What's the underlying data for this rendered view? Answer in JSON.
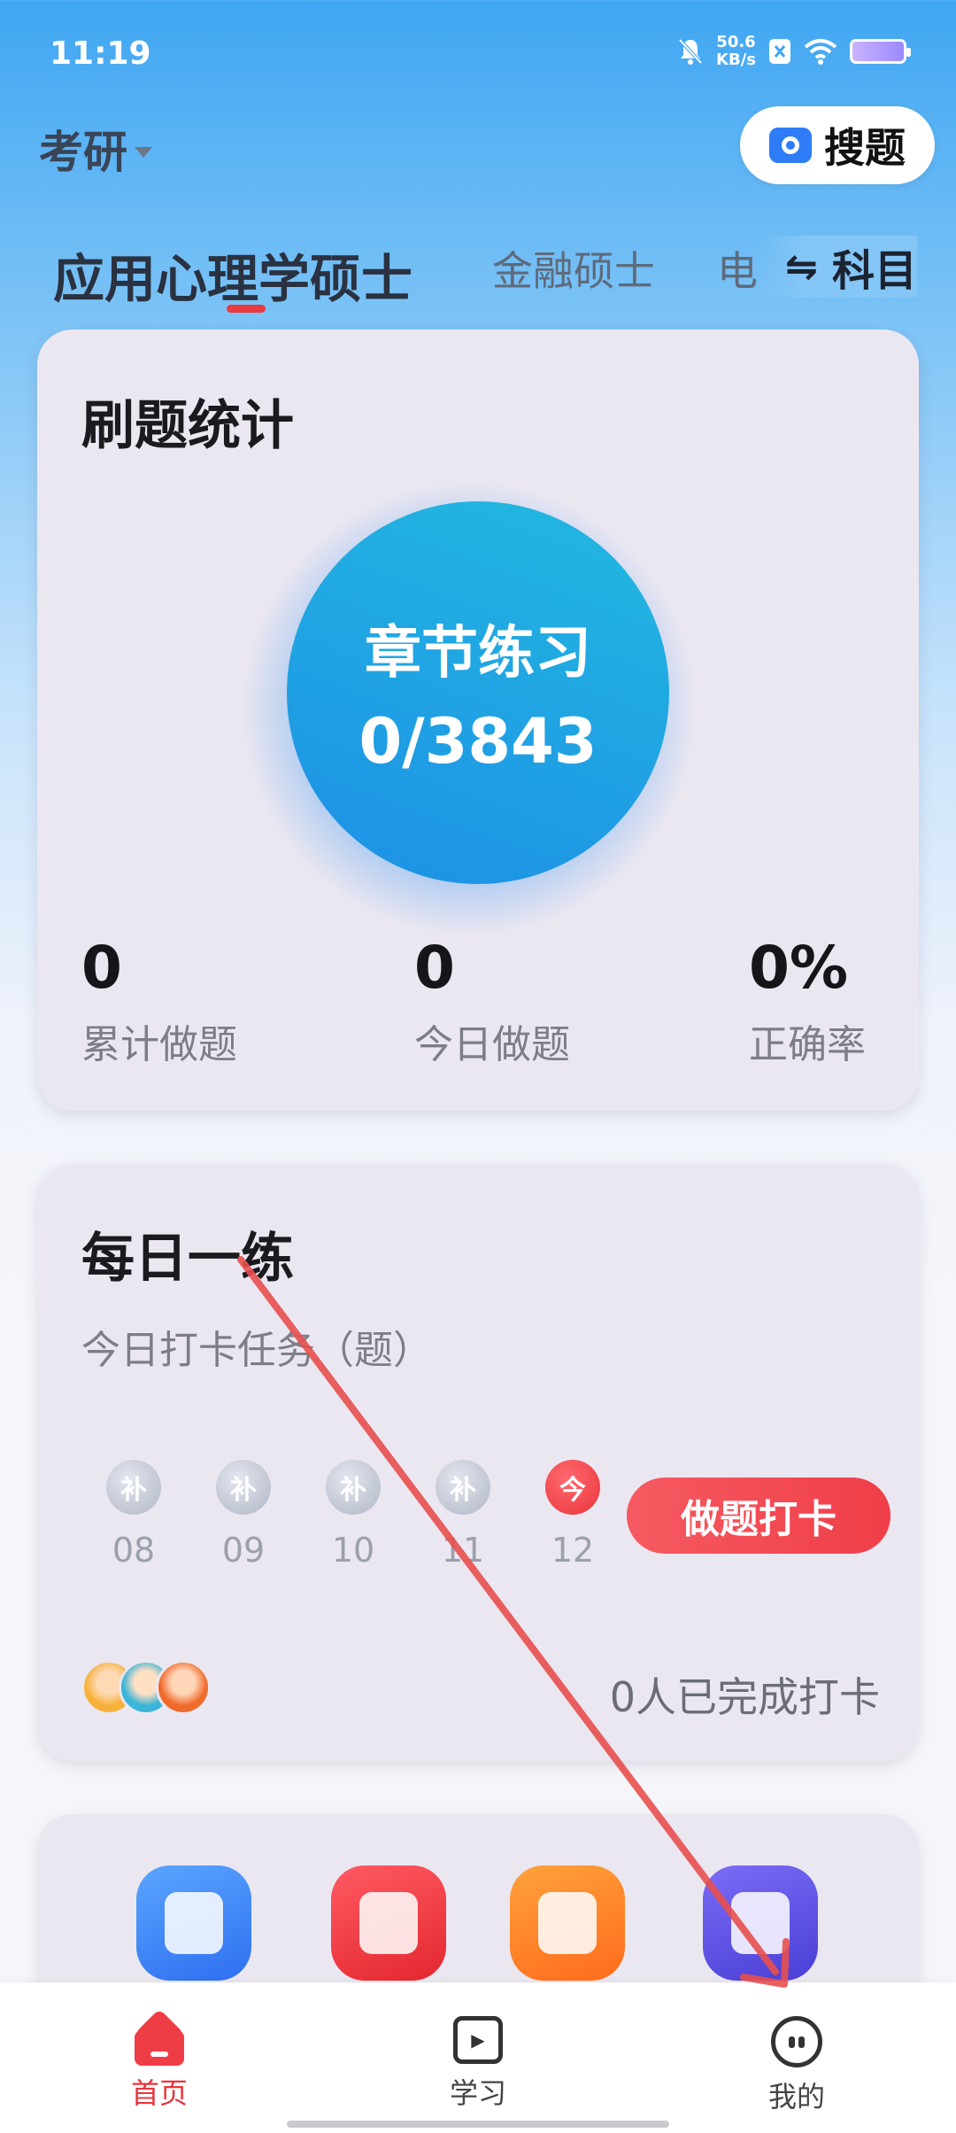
{
  "status_bar": {
    "time": "11:19",
    "net_speed_value": "50.6",
    "net_speed_unit": "KB/s"
  },
  "header": {
    "exam_type": "考研",
    "search_label": "搜题"
  },
  "subject_tabs": {
    "active": "应用心理学硕士",
    "others": [
      "金融硕士",
      "电"
    ],
    "switch_label": "科目",
    "switch_icon": "⇋"
  },
  "stats_card": {
    "title": "刷题统计",
    "circle_label": "章节练习",
    "circle_value": "0/3843",
    "stats": [
      {
        "value": "0",
        "label": "累计做题"
      },
      {
        "value": "0",
        "label": "今日做题"
      },
      {
        "value": "0%",
        "label": "正确率"
      }
    ]
  },
  "daily_card": {
    "title": "每日一练",
    "subtitle": "今日打卡任务（题）",
    "days": [
      {
        "badge": "补",
        "num": "08"
      },
      {
        "badge": "补",
        "num": "09"
      },
      {
        "badge": "补",
        "num": "10"
      },
      {
        "badge": "补",
        "num": "11"
      },
      {
        "badge": "今",
        "num": "12"
      }
    ],
    "checkin_button": "做题打卡",
    "checkin_count": "0人已完成打卡"
  },
  "bottom_nav": {
    "home": "首页",
    "study": "学习",
    "me": "我的"
  },
  "colors": {
    "accent_red": "#e8343c",
    "circle_blue": "#1d8fe6",
    "header_blue": "#3fa6f2"
  },
  "icons": [
    "bell-off-icon",
    "wifi-icon",
    "battery-icon",
    "camera-icon",
    "swap-icon",
    "home-icon",
    "study-icon",
    "me-icon"
  ]
}
